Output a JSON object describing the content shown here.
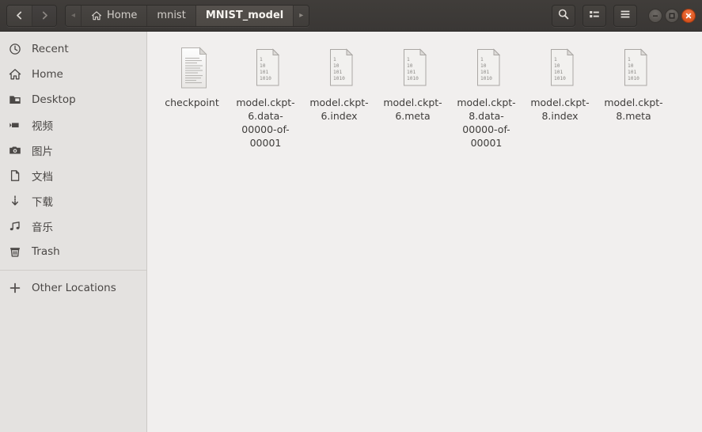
{
  "window": {
    "title": "MNIST_model",
    "nav": {
      "back_label": "Back",
      "back_icon": "chevron-left-icon",
      "forward_label": "Forward",
      "forward_icon": "chevron-right-icon"
    },
    "controls": {
      "minimize_label": "Minimize",
      "maximize_label": "Maximize",
      "close_label": "Close"
    }
  },
  "breadcrumb": {
    "left_arrow": "◂",
    "right_arrow": "▸",
    "items": [
      {
        "label": "Home",
        "icon": "home-icon",
        "active": false
      },
      {
        "label": "mnist",
        "icon": "",
        "active": false
      },
      {
        "label": "MNIST_model",
        "icon": "",
        "active": true
      }
    ]
  },
  "toolbar": {
    "search_label": "Search",
    "search_icon": "search-icon",
    "view_toggle_label": "View options",
    "view_toggle_icon": "list-view-icon",
    "menu_label": "Menu",
    "menu_icon": "hamburger-menu-icon"
  },
  "sidebar": {
    "items": [
      {
        "label": "Recent",
        "icon": "clock-icon"
      },
      {
        "label": "Home",
        "icon": "home-icon"
      },
      {
        "label": "Desktop",
        "icon": "folder-icon"
      },
      {
        "label": "视频",
        "icon": "video-camera-icon"
      },
      {
        "label": "图片",
        "icon": "photo-camera-icon"
      },
      {
        "label": "文档",
        "icon": "document-icon"
      },
      {
        "label": "下载",
        "icon": "download-icon"
      },
      {
        "label": "音乐",
        "icon": "music-note-icon"
      },
      {
        "label": "Trash",
        "icon": "trash-icon"
      }
    ],
    "other_locations": {
      "label": "Other Locations",
      "icon": "plus-icon"
    }
  },
  "files": [
    {
      "name": "checkpoint",
      "icon": "text-file-icon"
    },
    {
      "name": "model.ckpt-6.data-00000-of-00001",
      "icon": "binary-file-icon"
    },
    {
      "name": "model.ckpt-6.index",
      "icon": "binary-file-icon"
    },
    {
      "name": "model.ckpt-6.meta",
      "icon": "binary-file-icon"
    },
    {
      "name": "model.ckpt-8.data-00000-of-00001",
      "icon": "binary-file-icon"
    },
    {
      "name": "model.ckpt-8.index",
      "icon": "binary-file-icon"
    },
    {
      "name": "model.ckpt-8.meta",
      "icon": "binary-file-icon"
    }
  ],
  "binary_icon_text": [
    "1",
    "10",
    "101",
    "1010"
  ],
  "colors": {
    "headerbar": "#3e3b39",
    "sidebar": "#e4e2e0",
    "content": "#f1efee",
    "close_button": "#df5821",
    "active_crumb_text": "#f6f3ef"
  }
}
